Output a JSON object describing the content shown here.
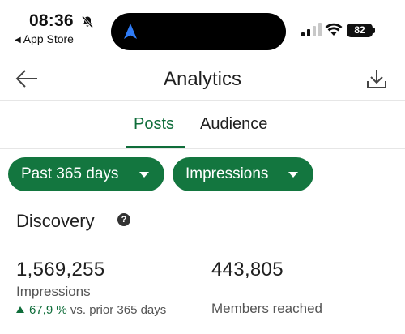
{
  "status_bar": {
    "time": "08:36",
    "back_app": "App Store",
    "battery": "82",
    "icons": [
      "bell-muted-icon",
      "navigation-arrow-icon",
      "cellular-signal-icon",
      "wifi-icon",
      "battery-icon"
    ]
  },
  "header": {
    "title": "Analytics",
    "icons": [
      "back-arrow-icon",
      "download-icon"
    ]
  },
  "tabs": [
    {
      "label": "Posts",
      "active": true
    },
    {
      "label": "Audience",
      "active": false
    }
  ],
  "filters": {
    "range": "Past 365 days",
    "metric": "Impressions"
  },
  "discovery": {
    "title": "Discovery",
    "help_icon": "?",
    "metrics": [
      {
        "value": "1,569,255",
        "label": "Impressions",
        "change": "67,9 %",
        "change_suffix": "vs. prior 365 days"
      },
      {
        "value": "443,805",
        "label": "Members reached"
      }
    ]
  },
  "colors": {
    "accent": "#0f6d3a",
    "chip_bg": "#13763f"
  }
}
